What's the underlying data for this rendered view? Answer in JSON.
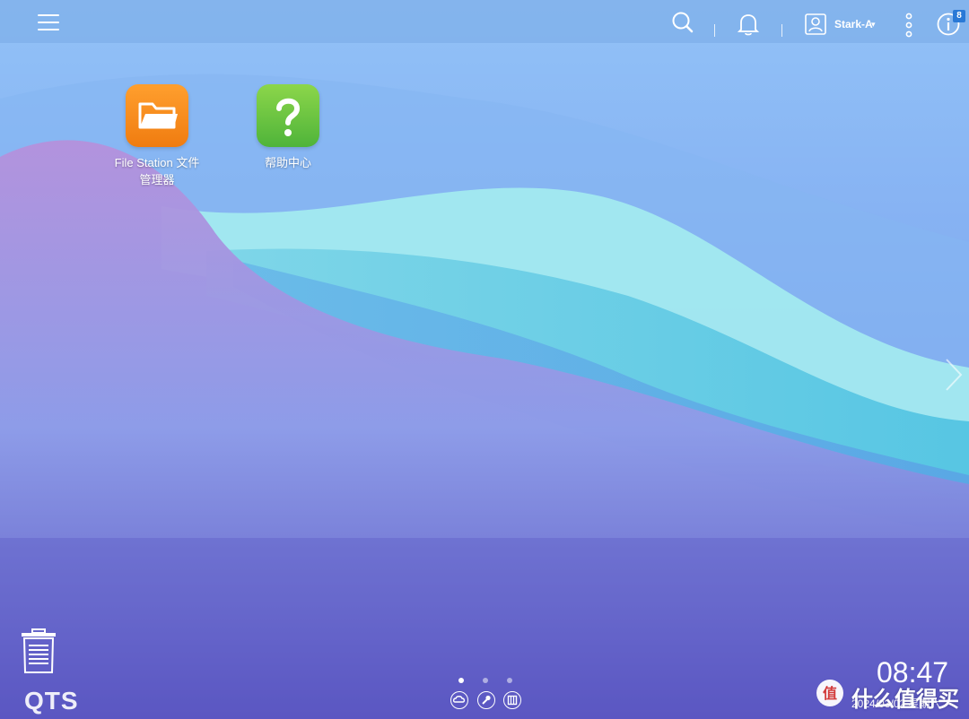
{
  "colors": {
    "topbar": "#7aaae6",
    "file_station_tile": "#f7901e",
    "help_tile": "#6cc63c",
    "badge": "#2a79d6"
  },
  "topbar": {
    "menu_icon": "hamburger-menu-icon",
    "search_icon": "search-icon",
    "notification_icon": "bell-icon",
    "user_icon": "user-icon",
    "user_name": "Stark-A",
    "user_caret": "▾",
    "more_icon": "vertical-dots-icon",
    "info_icon": "info-icon",
    "info_badge": "8"
  },
  "desktop": {
    "apps": [
      {
        "label_line1": "File Station 文件",
        "label_line2": "管理器",
        "icon": "folder-icon"
      },
      {
        "label_line1": "帮助中心",
        "label_line2": "",
        "icon": "question-mark-icon"
      }
    ],
    "next_page_icon": "chevron-right-icon"
  },
  "bottom": {
    "trash_icon": "recycle-bin-icon",
    "logo": "QTS",
    "page_count": 3,
    "active_page": 1,
    "dock_icons": [
      "myqnapcloud-icon",
      "tools-icon",
      "dashboard-icon"
    ],
    "time": "08:47",
    "date": "2024/03/02 星期六",
    "watermark_text": "什么值得买",
    "watermark_icon": "smzdm-logo-icon"
  }
}
